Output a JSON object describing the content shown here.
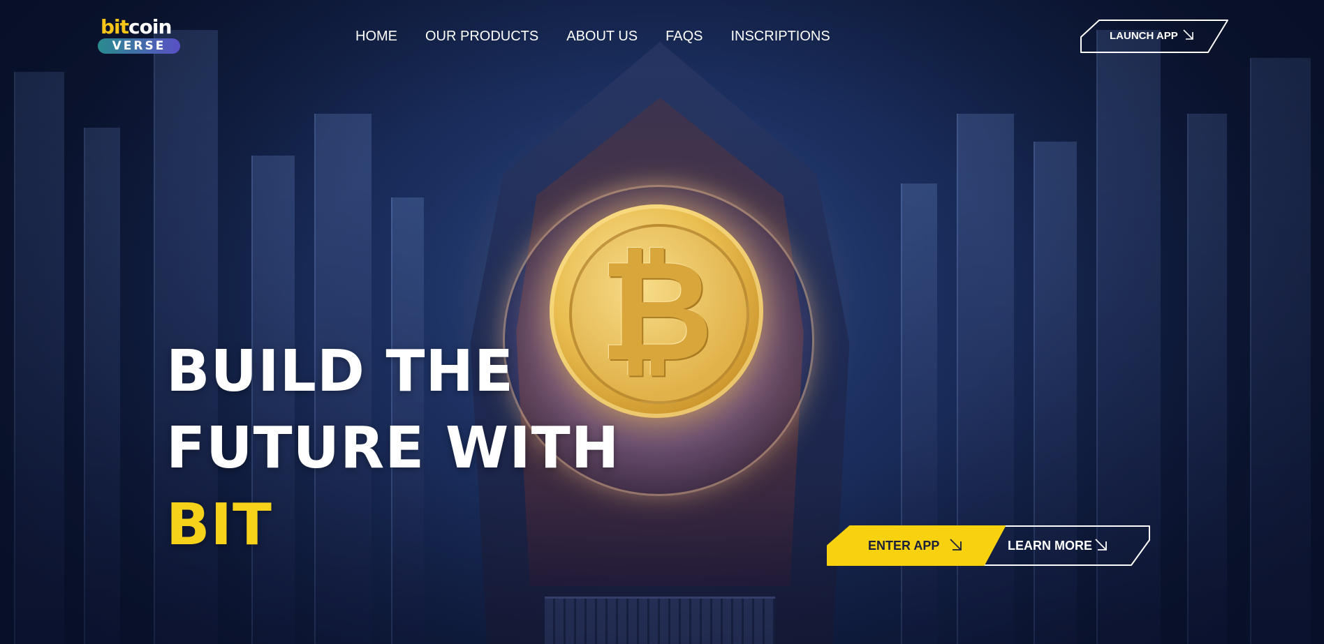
{
  "brand": {
    "logo_top_bit": "bit",
    "logo_top_coin": "coin",
    "logo_bottom": "VERSE",
    "colors": {
      "accent_yellow": "#f7d21a",
      "background_navy": "#1a2d5c"
    }
  },
  "nav": {
    "items": [
      {
        "label": "HOME"
      },
      {
        "label": "OUR PRODUCTS"
      },
      {
        "label": "ABOUT US"
      },
      {
        "label": "FAQS"
      },
      {
        "label": "INSCRIPTIONS"
      }
    ]
  },
  "header": {
    "launch_label": "LAUNCH APP",
    "launch_icon": "arrow-down-right-icon"
  },
  "hero": {
    "line1": "BUILD THE",
    "line2": "FUTURE WITH",
    "line3": "BIT",
    "image": "bitcoin-coin-icon"
  },
  "cta": {
    "enter_label": "ENTER APP",
    "learn_label": "LEARN MORE",
    "icon": "arrow-down-right-icon"
  }
}
